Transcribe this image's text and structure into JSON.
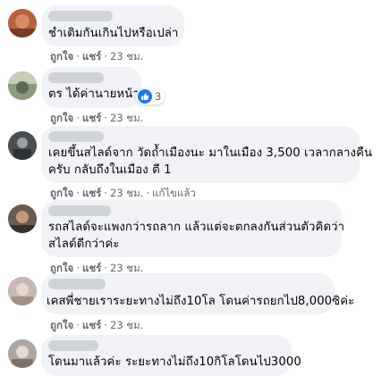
{
  "action_labels": {
    "like": "ถูกใจ",
    "share": "แชร์",
    "edited": "แก้ไขแล้ว",
    "separator": "·"
  },
  "colors": {
    "bubble": "#f0f2f5",
    "meta_text": "#65676b",
    "like_blue": "#1877f2"
  },
  "comments": [
    {
      "text_lines": [
        "ชำเติมกันเกินไปหรือเปล่า"
      ],
      "timestamp": "23 ชม.",
      "edited": false,
      "reaction_count": ""
    },
    {
      "text_lines": [
        "ตร ได้ค่านายหน้า"
      ],
      "timestamp": "23 ชม.",
      "edited": false,
      "reaction_icon": "like-icon",
      "reaction_count": "3"
    },
    {
      "text_lines": [
        "เคยขึ้นสไลด์จาก วัดถ้ำเมืองนะ มาในเมือง 3,500 เวลากลางคืน",
        "ครับ กลับถึงในเมือง ตี 1"
      ],
      "timestamp": "23 ชม.",
      "edited": true,
      "reaction_count": ""
    },
    {
      "text_lines": [
        "รถสไลด์จะแพงกว่ารถลาก แล้วแต่จะตกลงกันส่วนตัวคิดว่า",
        "สไลด์ดีกว่าค่ะ"
      ],
      "timestamp": "23 ชม.",
      "edited": false,
      "reaction_count": ""
    },
    {
      "text_lines": [
        "เคสพี่ชายเราระยะทางไม่ถึง10โล โดนค่ารถยกไป8,000ซิค่ะ"
      ],
      "timestamp": "23 ชม.",
      "edited": false,
      "reaction_count": ""
    },
    {
      "text_lines": [
        "โดนมาแล้วค่ะ ระยะทางไม่ถึง10กิโลโดนไป3000"
      ],
      "timestamp": "",
      "edited": false,
      "reaction_count": ""
    }
  ]
}
